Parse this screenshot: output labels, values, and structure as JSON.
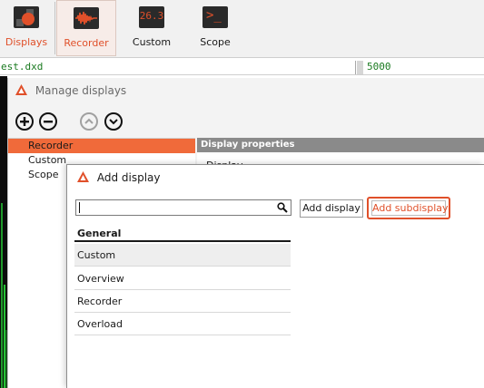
{
  "ribbon": {
    "buttons": [
      {
        "label": "Displays",
        "icon": "displays-icon"
      },
      {
        "label": "Recorder",
        "icon": "recorder-waveform-icon"
      },
      {
        "label": "Custom",
        "icon": "custom-digital-readout-icon",
        "readout": "26.3"
      },
      {
        "label": "Scope",
        "icon": "scope-terminal-icon",
        "prompt": ">_"
      }
    ],
    "accent_color": "#e0502a"
  },
  "filebar": {
    "file_name": "est.dxd",
    "value": "5000"
  },
  "manage_displays": {
    "title": "Manage displays",
    "toolbar": [
      "add-icon",
      "remove-icon",
      "move-up-icon",
      "move-down-icon"
    ],
    "tree": [
      {
        "label": "Recorder",
        "selected": true
      },
      {
        "label": "Custom",
        "selected": false
      },
      {
        "label": "Scope",
        "selected": false
      }
    ],
    "properties_header": "Display properties",
    "properties_row_text": "Display"
  },
  "add_display": {
    "title": "Add display",
    "search": {
      "value": "",
      "placeholder": ""
    },
    "add_button": "Add display",
    "add_sub_button": "Add subdisplay",
    "list_header": "General",
    "items": [
      {
        "label": "Custom",
        "selected": true
      },
      {
        "label": "Overview",
        "selected": false
      },
      {
        "label": "Recorder",
        "selected": false
      },
      {
        "label": "Overload",
        "selected": false
      }
    ]
  }
}
